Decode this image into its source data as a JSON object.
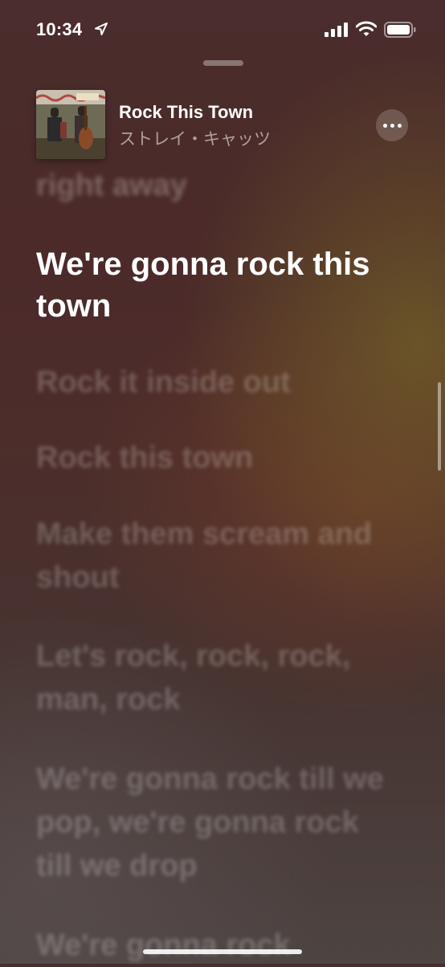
{
  "status_bar": {
    "time": "10:34"
  },
  "now_playing": {
    "title": "Rock This Town",
    "artist": "ストレイ・キャッツ"
  },
  "lyrics": {
    "previous": "right away",
    "current": "We're gonna rock this town",
    "upcoming": [
      "Rock it inside out",
      "Rock this town",
      "Make them scream and shout",
      "Let's rock, rock, rock, man, rock",
      "We're gonna rock till we pop, we're gonna rock till we drop",
      "We're gonna rock"
    ]
  },
  "icons": {
    "location": "location-arrow-icon",
    "signal": "cellular-signal-icon",
    "wifi": "wifi-icon",
    "battery": "battery-icon",
    "more": "ellipsis-icon"
  }
}
